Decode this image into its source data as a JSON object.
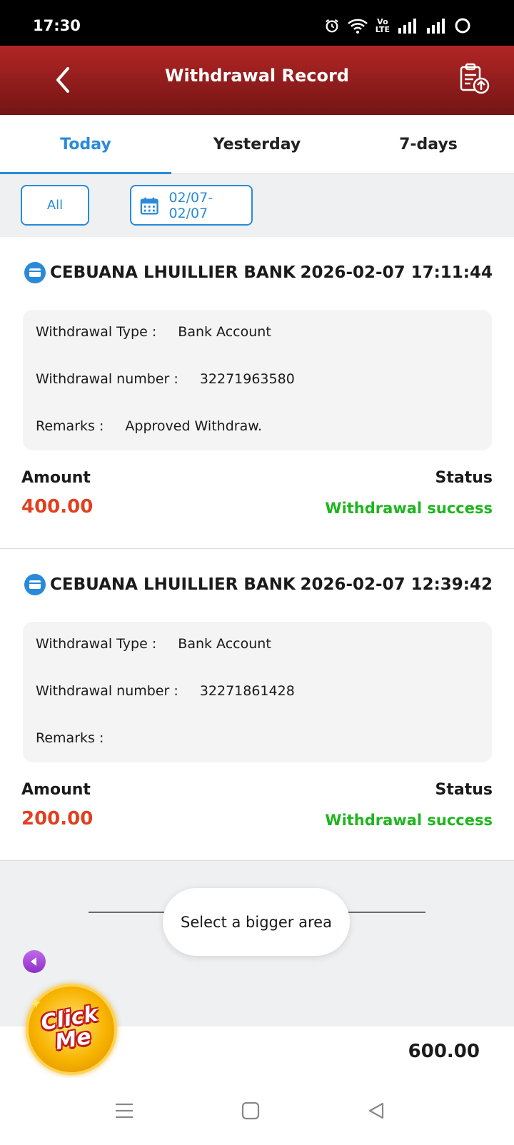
{
  "status_bar": {
    "time": "17:30",
    "volte_top": "Vo",
    "volte_bottom": "LTE"
  },
  "header": {
    "title": "Withdrawal Record"
  },
  "tabs": [
    {
      "label": "Today",
      "active": true
    },
    {
      "label": "Yesterday",
      "active": false
    },
    {
      "label": "7-days",
      "active": false
    }
  ],
  "filters": {
    "all_label": "All",
    "date_range": "02/07- 02/07"
  },
  "labels": {
    "type": "Withdrawal Type :",
    "number": "Withdrawal number :",
    "remarks": "Remarks :",
    "amount": "Amount",
    "status": "Status"
  },
  "records": [
    {
      "bank": "CEBUANA LHUILLIER BANK",
      "time": "2026-02-07 17:11:44",
      "type": "Bank Account",
      "number": "32271963580",
      "remarks": "Approved Withdraw.",
      "amount": "400.00",
      "status": "Withdrawal success"
    },
    {
      "bank": "CEBUANA LHUILLIER BANK",
      "time": "2026-02-07 12:39:42",
      "type": "Bank Account",
      "number": "32271861428",
      "remarks": "",
      "amount": "200.00",
      "status": "Withdrawal success"
    }
  ],
  "toast": {
    "text": "Select a bigger area"
  },
  "footer": {
    "total": "600.00"
  },
  "promo": {
    "label_line1": "Click",
    "label_line2": "Me"
  },
  "colors": {
    "header_red": "#b32525",
    "accent_blue": "#2a8ad9",
    "amount_red": "#e0401f",
    "success_green": "#1fb51f"
  },
  "icons": [
    "alarm-icon",
    "wifi-icon",
    "signal-icon",
    "battery-icon",
    "back-arrow-icon",
    "upload-record-icon",
    "calendar-icon",
    "bank-icon",
    "play-left-icon",
    "menu-icon",
    "home-square-icon",
    "back-triangle-icon"
  ]
}
